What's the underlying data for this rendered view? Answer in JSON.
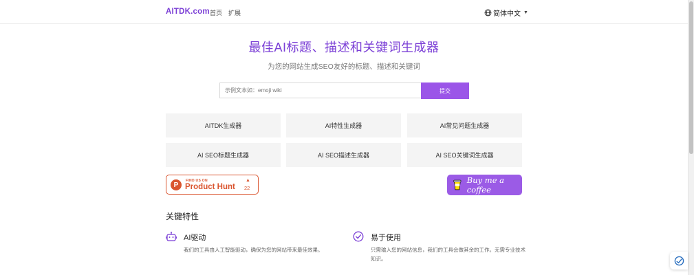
{
  "header": {
    "logo": "AITDK.com",
    "nav": [
      "首页",
      "扩展"
    ],
    "language": "简体中文",
    "icons": {
      "language": "globe-icon",
      "language_chevron": "chevron-down-icon"
    }
  },
  "hero": {
    "title": "最佳AI标题、描述和关键词生成器",
    "subtitle": "为您的网站生成SEO友好的标题、描述和关键词",
    "search_placeholder": "示例文本如：emoji wiki",
    "submit_label": "提交"
  },
  "tools": [
    "AITDK生成器",
    "AI特性生成器",
    "AI常见问题生成器",
    "AI SEO标题生成器",
    "AI SEO描述生成器",
    "AI SEO关键词生成器"
  ],
  "badges": {
    "product_hunt": {
      "logo_letter": "P",
      "small": "FIND US ON",
      "big": "Product Hunt",
      "arrow": "▲",
      "count": "22"
    },
    "bmc": {
      "label": "Buy me a coffee",
      "icon": "coffee-cup-icon"
    }
  },
  "features": {
    "title": "关键特性",
    "items": [
      {
        "title": "AI驱动",
        "desc": "我们的工具由人工智能驱动，确保为您的网站带来最佳效果。",
        "icon": "robot-icon"
      },
      {
        "title": "易于使用",
        "desc": "只需输入您的网站信息，我们的工具会做其余的工作。无需专业技术知识。",
        "icon": "check-circle-icon"
      }
    ]
  },
  "colors": {
    "brand": "#7b3fd6",
    "button": "#9b55e8",
    "product_hunt": "#da552f",
    "card_bg": "#f4f4f4"
  }
}
